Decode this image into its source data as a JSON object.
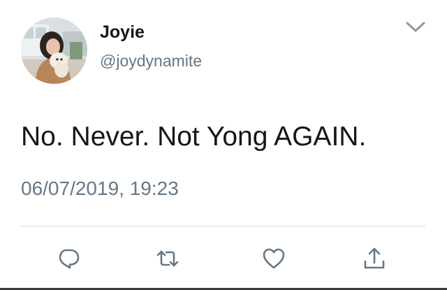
{
  "user": {
    "display_name": "Joyie",
    "handle": "@joydynamite",
    "avatar": "profile-photo"
  },
  "tweet": {
    "text": "No. Never. Not Yong AGAIN.",
    "timestamp": "06/07/2019, 19:23"
  },
  "icons": {
    "menu": "chevron-down-icon",
    "reply": "reply-icon",
    "retweet": "retweet-icon",
    "like": "heart-icon",
    "share": "share-icon"
  },
  "colors": {
    "text": "#14171a",
    "secondary_text": "#657786",
    "icon": "#657786",
    "divider": "#d6dde3"
  }
}
